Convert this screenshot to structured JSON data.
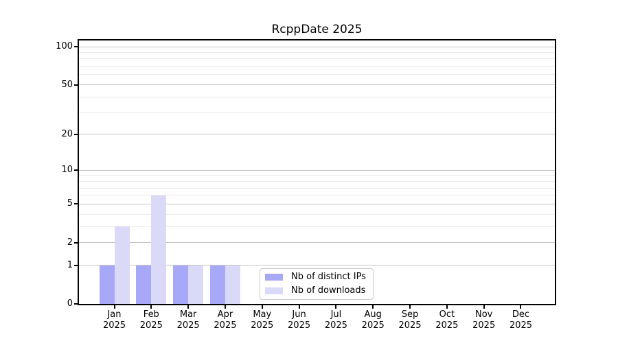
{
  "chart_data": {
    "type": "bar",
    "title": "RcppDate 2025",
    "x_tick_year": "2025",
    "categories": [
      "Jan",
      "Feb",
      "Mar",
      "Apr",
      "May",
      "Jun",
      "Jul",
      "Aug",
      "Sep",
      "Oct",
      "Nov",
      "Dec"
    ],
    "series": [
      {
        "name": "Nb of distinct IPs",
        "color": "#a8a8f8",
        "values": [
          1,
          1,
          1,
          1,
          0,
          0,
          0,
          0,
          0,
          0,
          0,
          0
        ]
      },
      {
        "name": "Nb of downloads",
        "color": "#dadaf8",
        "values": [
          3,
          6,
          1,
          1,
          0,
          0,
          0,
          0,
          0,
          0,
          0,
          0
        ]
      }
    ],
    "y_axis": {
      "scale": "log1p",
      "ticks": [
        0,
        1,
        2,
        5,
        10,
        20,
        50,
        100
      ],
      "minor_gridlines": [
        3,
        4,
        6,
        7,
        8,
        9,
        30,
        40,
        60,
        70,
        80,
        90
      ],
      "lim": [
        0,
        100
      ]
    },
    "grid": {
      "major_color": "#c4c4c4",
      "minor_color": "#eaeaea"
    },
    "spine_color": "#000000",
    "legend": {
      "position": "lower-center"
    }
  }
}
